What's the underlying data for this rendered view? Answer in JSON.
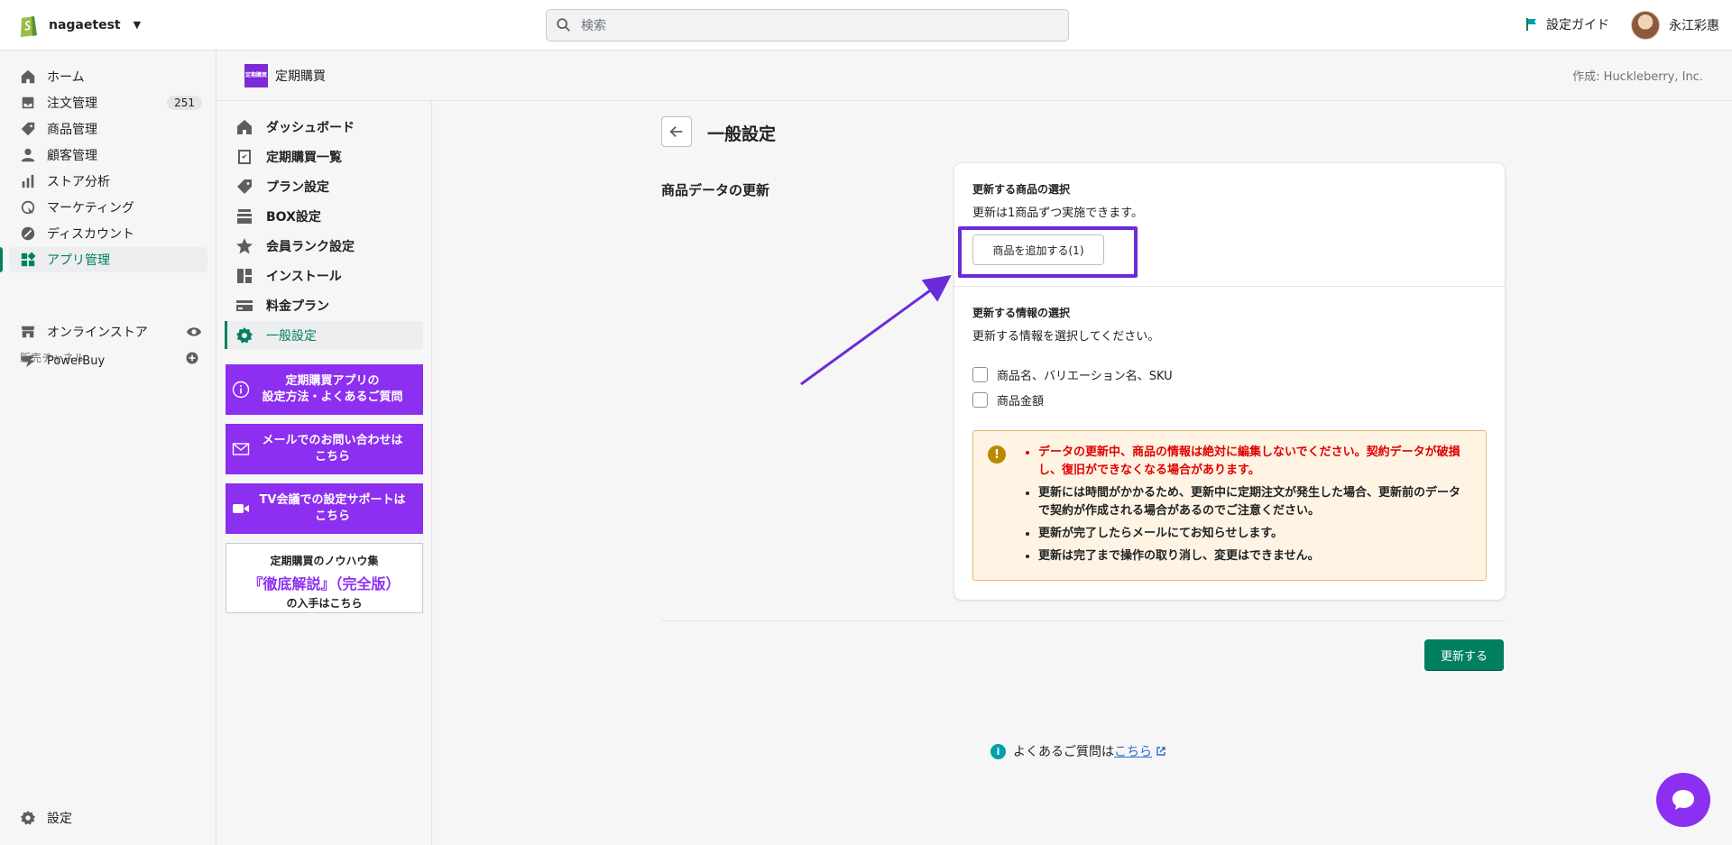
{
  "topbar": {
    "store_name": "nagaetest",
    "search_placeholder": "検索",
    "guide_label": "設定ガイド",
    "user_name": "永江彩惠"
  },
  "leftnav": {
    "items": [
      {
        "label": "ホーム",
        "icon": "home-icon"
      },
      {
        "label": "注文管理",
        "icon": "orders-icon",
        "badge": "251"
      },
      {
        "label": "商品管理",
        "icon": "tag-icon"
      },
      {
        "label": "顧客管理",
        "icon": "customer-icon"
      },
      {
        "label": "ストア分析",
        "icon": "analytics-icon"
      },
      {
        "label": "マーケティング",
        "icon": "marketing-icon"
      },
      {
        "label": "ディスカウント",
        "icon": "discount-icon"
      },
      {
        "label": "アプリ管理",
        "icon": "apps-icon",
        "active": true
      }
    ],
    "channels_label": "販売チャネル",
    "channels": [
      {
        "label": "オンラインストア",
        "icon": "store-icon"
      },
      {
        "label": "PowerBuy",
        "icon": "powerbuy-icon"
      }
    ],
    "settings_label": "設定"
  },
  "app_header": {
    "logo_text": "定期購買",
    "title": "定期購買",
    "by": "作成: Huckleberry, Inc."
  },
  "app_nav": {
    "items": [
      {
        "label": "ダッシュボード",
        "icon": "home-icon"
      },
      {
        "label": "定期購買一覧",
        "icon": "list-icon"
      },
      {
        "label": "プラン設定",
        "icon": "tag-icon"
      },
      {
        "label": "BOX設定",
        "icon": "box-icon"
      },
      {
        "label": "会員ランク設定",
        "icon": "star-icon"
      },
      {
        "label": "インストール",
        "icon": "install-icon"
      },
      {
        "label": "料金プラン",
        "icon": "credit-card-icon"
      },
      {
        "label": "一般設定",
        "icon": "gear-icon",
        "active": true
      }
    ],
    "promos": [
      {
        "line1": "定期購買アプリの",
        "line2": "設定方法・よくあるご質問",
        "icon": "info-icon"
      },
      {
        "line1": "メールでのお問い合わせは",
        "line2": "こちら",
        "icon": "mail-icon"
      },
      {
        "line1": "TV会議での設定サポートは",
        "line2": "こちら",
        "icon": "video-icon"
      }
    ],
    "knowhow": {
      "line1": "定期購買のノウハウ集",
      "line2": "『徹底解説』（完全版）",
      "line3": "の入手はこちら"
    }
  },
  "main": {
    "page_title": "一般設定",
    "section_title": "商品データの更新",
    "product_select_heading": "更新する商品の選択",
    "product_select_help": "更新は1商品ずつ実施できます。",
    "add_product_button": "商品を追加する(1)",
    "info_select_heading": "更新する情報の選択",
    "info_select_help": "更新する情報を選択してください。",
    "checkboxes": [
      {
        "label": "商品名、バリエーション名、SKU",
        "checked": false
      },
      {
        "label": "商品金額",
        "checked": false
      }
    ],
    "warnings": [
      "データの更新中、商品の情報は絶対に編集しないでください。契約データが破損し、復旧ができなくなる場合があります。",
      "更新には時間がかかるため、更新中に定期注文が発生した場合、更新前のデータで契約が作成される場合があるのでご注意ください。",
      "更新が完了したらメールにてお知らせします。",
      "更新は完了まで操作の取り消し、変更はできません。"
    ],
    "update_button": "更新する",
    "faq_text": "よくあるご質問は",
    "faq_link": "こちら"
  },
  "colors": {
    "accent_green": "#008060",
    "purple": "#8c2ff0",
    "highlight": "#6a2bd9",
    "warning_red": "#e00000"
  }
}
